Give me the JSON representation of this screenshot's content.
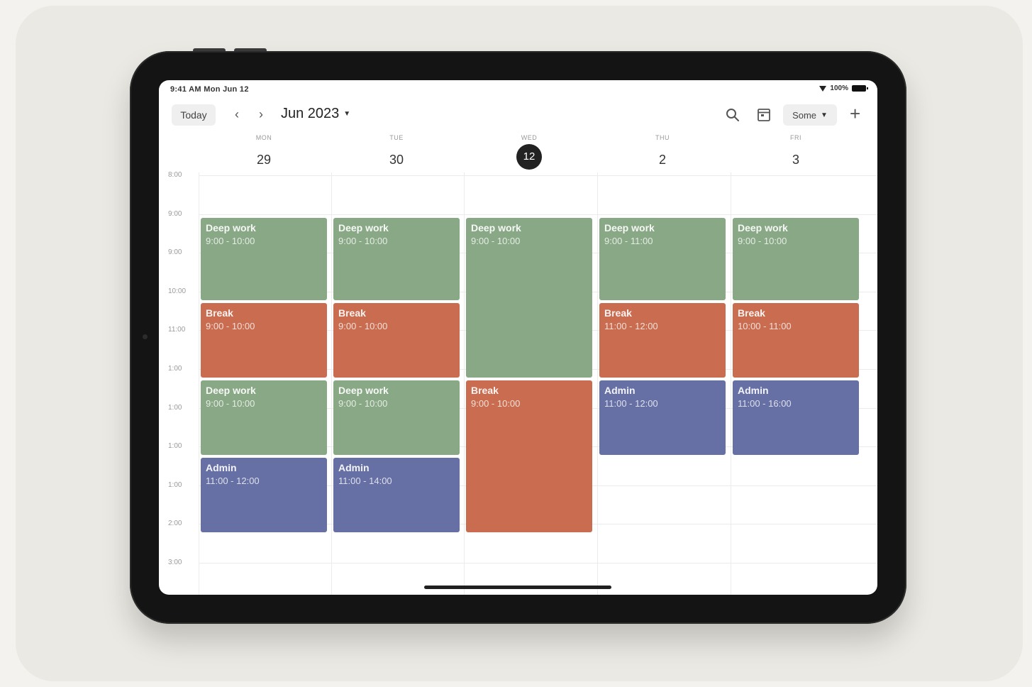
{
  "status_bar": {
    "left_text": "9:41 AM  Mon Jun 12",
    "right_text": "100%"
  },
  "toolbar": {
    "today_label": "Today",
    "prev_icon": "chevron-left-icon",
    "next_icon": "chevron-right-icon",
    "month_label": "Jun 2023",
    "view_label": "Some",
    "search_icon": "search-icon",
    "calendar_icon": "calendar-icon",
    "add_icon": "plus-icon"
  },
  "days": [
    {
      "name": "MON",
      "number": "29",
      "is_today": false
    },
    {
      "name": "TUE",
      "number": "30",
      "is_today": false
    },
    {
      "name": "WED",
      "number": "12",
      "is_today": true
    },
    {
      "name": "THU",
      "number": "2",
      "is_today": false
    },
    {
      "name": "FRI",
      "number": "3",
      "is_today": false
    }
  ],
  "hours": [
    "8:00",
    "9:00",
    "9:00",
    "10:00",
    "11:00",
    "1:00",
    "1:00",
    "1:00",
    "1:00",
    "2:00",
    "3:00"
  ],
  "colors": {
    "green": "#88a886",
    "orange": "#c96c4f",
    "blue": "#6670a5"
  },
  "events": [
    {
      "day": 0,
      "start": 1,
      "end": 3.2,
      "color": "green",
      "title": "Deep work",
      "time": "9:00 - 10:00"
    },
    {
      "day": 0,
      "start": 3.2,
      "end": 5.2,
      "color": "orange",
      "title": "Break",
      "time": "9:00 - 10:00"
    },
    {
      "day": 0,
      "start": 5.2,
      "end": 7.2,
      "color": "green",
      "title": "Deep work",
      "time": "9:00 - 10:00"
    },
    {
      "day": 0,
      "start": 7.2,
      "end": 9.2,
      "color": "blue",
      "title": "Admin",
      "time": "11:00 - 12:00"
    },
    {
      "day": 1,
      "start": 1,
      "end": 3.2,
      "color": "green",
      "title": "Deep work",
      "time": "9:00 - 10:00"
    },
    {
      "day": 1,
      "start": 3.2,
      "end": 5.2,
      "color": "orange",
      "title": "Break",
      "time": "9:00 - 10:00"
    },
    {
      "day": 1,
      "start": 5.2,
      "end": 7.2,
      "color": "green",
      "title": "Deep work",
      "time": "9:00 - 10:00"
    },
    {
      "day": 1,
      "start": 7.2,
      "end": 9.2,
      "color": "blue",
      "title": "Admin",
      "time": "11:00 - 14:00"
    },
    {
      "day": 2,
      "start": 1,
      "end": 5.2,
      "color": "green",
      "title": "Deep work",
      "time": "9:00 - 10:00"
    },
    {
      "day": 2,
      "start": 5.2,
      "end": 9.2,
      "color": "orange",
      "title": "Break",
      "time": "9:00 - 10:00"
    },
    {
      "day": 3,
      "start": 1,
      "end": 3.2,
      "color": "green",
      "title": "Deep work",
      "time": "9:00 - 11:00"
    },
    {
      "day": 3,
      "start": 3.2,
      "end": 5.2,
      "color": "orange",
      "title": "Break",
      "time": "11:00 - 12:00"
    },
    {
      "day": 3,
      "start": 5.2,
      "end": 7.2,
      "color": "blue",
      "title": "Admin",
      "time": "11:00 - 12:00"
    },
    {
      "day": 4,
      "start": 1,
      "end": 3.2,
      "color": "green",
      "title": "Deep work",
      "time": "9:00 - 10:00"
    },
    {
      "day": 4,
      "start": 3.2,
      "end": 5.2,
      "color": "orange",
      "title": "Break",
      "time": "10:00 - 11:00"
    },
    {
      "day": 4,
      "start": 5.2,
      "end": 7.2,
      "color": "blue",
      "title": "Admin",
      "time": "11:00 - 16:00"
    }
  ]
}
